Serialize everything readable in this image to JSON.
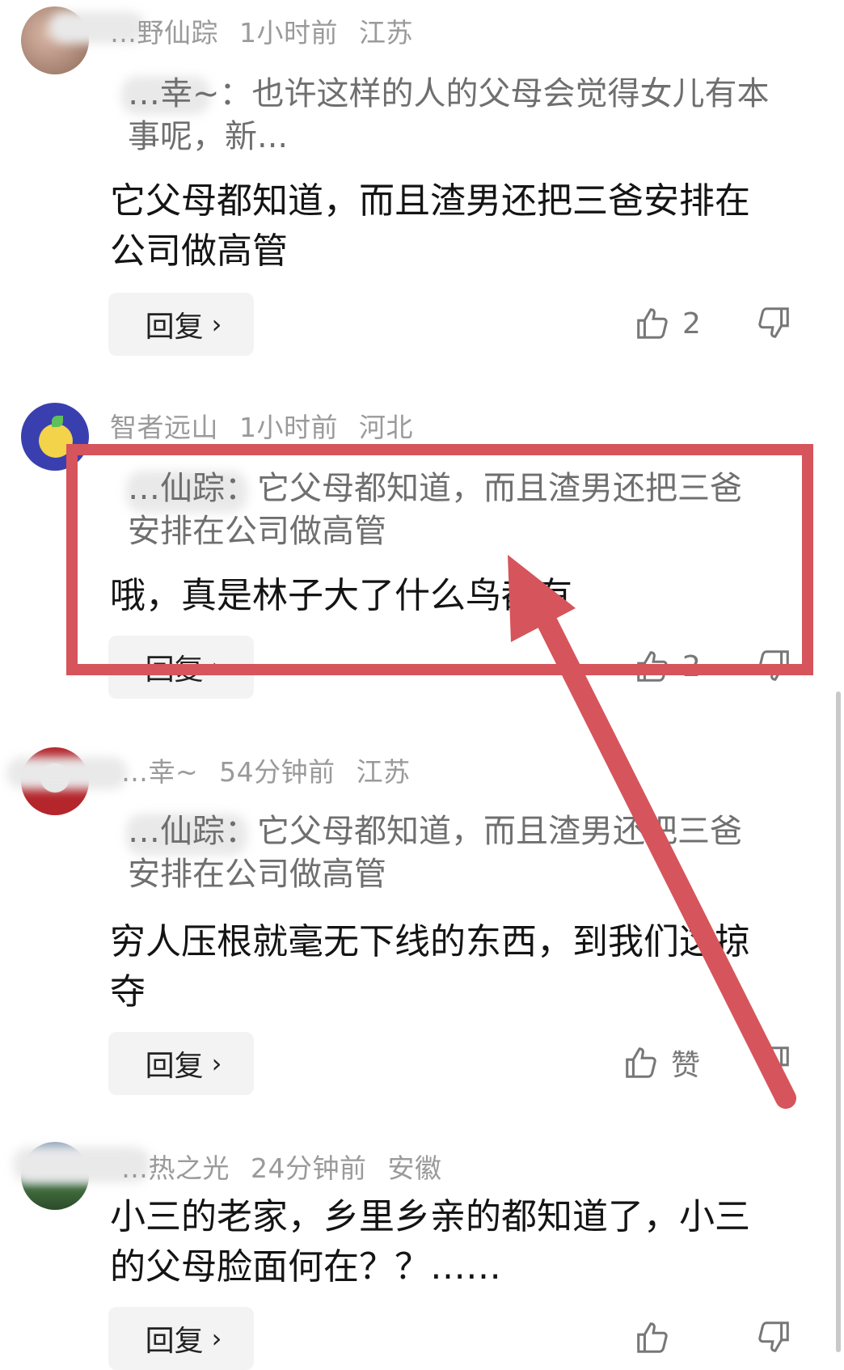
{
  "comments": [
    {
      "author": "…野仙踪",
      "time": "1小时前",
      "location": "江苏",
      "quote": "…幸~：也许这样的人的父母会觉得女儿有本事呢，新...",
      "text": "它父母都知道，而且渣男还把三爸安排在公司做高管",
      "reply_label": "回复",
      "like_label": "2"
    },
    {
      "author": "智者远山",
      "time": "1小时前",
      "location": "河北",
      "quote": "…仙踪：它父母都知道，而且渣男还把三爸安排在公司做高管",
      "text": "哦，真是林子大了什么鸟都有",
      "reply_label": "回复",
      "like_label": "2"
    },
    {
      "author": "…幸~",
      "time": "54分钟前",
      "location": "江苏",
      "quote": "…仙踪：它父母都知道，而且渣男还把三爸安排在公司做高管",
      "text": "穷人压根就毫无下线的东西，到我们这掠夺",
      "reply_label": "回复",
      "like_label": "赞"
    },
    {
      "author": "…热之光",
      "time": "24分钟前",
      "location": "安徽",
      "quote": "",
      "text": "小三的老家，乡里乡亲的都知道了，小三的父母脸面何在？？……",
      "reply_label": "回复",
      "like_label": ""
    }
  ],
  "icons": {
    "like": "thumbs-up-icon",
    "dislike": "thumbs-down-icon",
    "chevron": "chevron-right-icon"
  },
  "colors": {
    "highlight": "#d6545b",
    "meta": "#9a9a9a",
    "quote": "#6f6f6f"
  }
}
